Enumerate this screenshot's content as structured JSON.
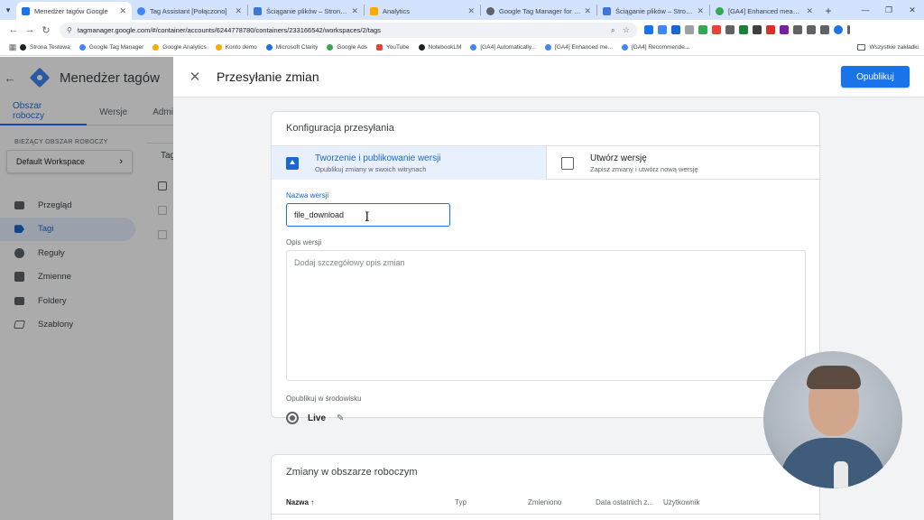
{
  "browser": {
    "tabs": [
      {
        "title": "Menedżer tagów Google",
        "active": true,
        "color": "#1a73e8"
      },
      {
        "title": "Tag Assistant [Połączono]",
        "active": false,
        "color": "#4285f4"
      },
      {
        "title": "Ściąganie plików – Strona Testowa",
        "active": false,
        "color": "#3c78d8"
      },
      {
        "title": "Analytics",
        "active": false,
        "color": "#f9ab00"
      },
      {
        "title": "Google Tag Manager for WordPress",
        "active": false,
        "color": "#5f6368"
      },
      {
        "title": "Ściąganie plików – Strona Testowa",
        "active": false,
        "color": "#3c78d8"
      },
      {
        "title": "[GA4] Enhanced measurement",
        "active": false,
        "color": "#34a853"
      }
    ],
    "url": "tagmanager.google.com/#/container/accounts/6244778780/containers/233166542/workspaces/2/tags",
    "bookmarks": [
      {
        "label": "Strona Testowa",
        "color": "#202124"
      },
      {
        "label": "Google Tag Manager",
        "color": "#4285f4"
      },
      {
        "label": "Google Analytics",
        "color": "#f9ab00"
      },
      {
        "label": "Konto demo",
        "color": "#f9ab00"
      },
      {
        "label": "Microsoft Clarity",
        "color": "#1a73e8"
      },
      {
        "label": "Google Ads",
        "color": "#34a853"
      },
      {
        "label": "YouTube",
        "color": "#ea4335"
      },
      {
        "label": "NotebookLM",
        "color": "#202124"
      },
      {
        "label": "[GA4] Automatically...",
        "color": "#4285f4"
      },
      {
        "label": "[GA4] Enhanced me...",
        "color": "#4285f4"
      },
      {
        "label": "[GA4] Recommende...",
        "color": "#4285f4"
      }
    ],
    "all_bookmarks": "Wszystkie zakładki"
  },
  "gtm": {
    "brand": "Menedżer tagów",
    "tabs": [
      "Obszar roboczy",
      "Wersje",
      "Admi"
    ],
    "workspace_label": "BIEŻĄCY OBSZAR ROBOCZY",
    "workspace_name": "Default Workspace",
    "nav": [
      "Przegląd",
      "Tagi",
      "Reguły",
      "Zmienne",
      "Foldery",
      "Szablony"
    ],
    "tags_panel_title": "Tag"
  },
  "submit": {
    "title": "Przesyłanie zmian",
    "publish_label": "Opublikuj",
    "config_title": "Konfiguracja przesyłania",
    "option1_title": "Tworzenie i publikowanie wersji",
    "option1_sub": "Opublikuj zmiany w swoich witrynach",
    "option2_title": "Utwórz wersję",
    "option2_sub": "Zapisz zmiany i utwórz nową wersję",
    "version_name_label": "Nazwa wersji",
    "version_name_value": "file_download",
    "description_label": "Opis wersji",
    "description_placeholder": "Dodaj szczegółowy opis zmian",
    "environment_label": "Opublikuj w środowisku",
    "environment_value": "Live",
    "changes_title": "Zmiany w obszarze roboczym",
    "columns": [
      "Nazwa",
      "Typ",
      "Zmieniono",
      "Data ostatnich z...",
      "Użytkownik"
    ]
  },
  "colors": {
    "accent": "#1a73e8",
    "selected_bg": "#e8f0fe"
  }
}
